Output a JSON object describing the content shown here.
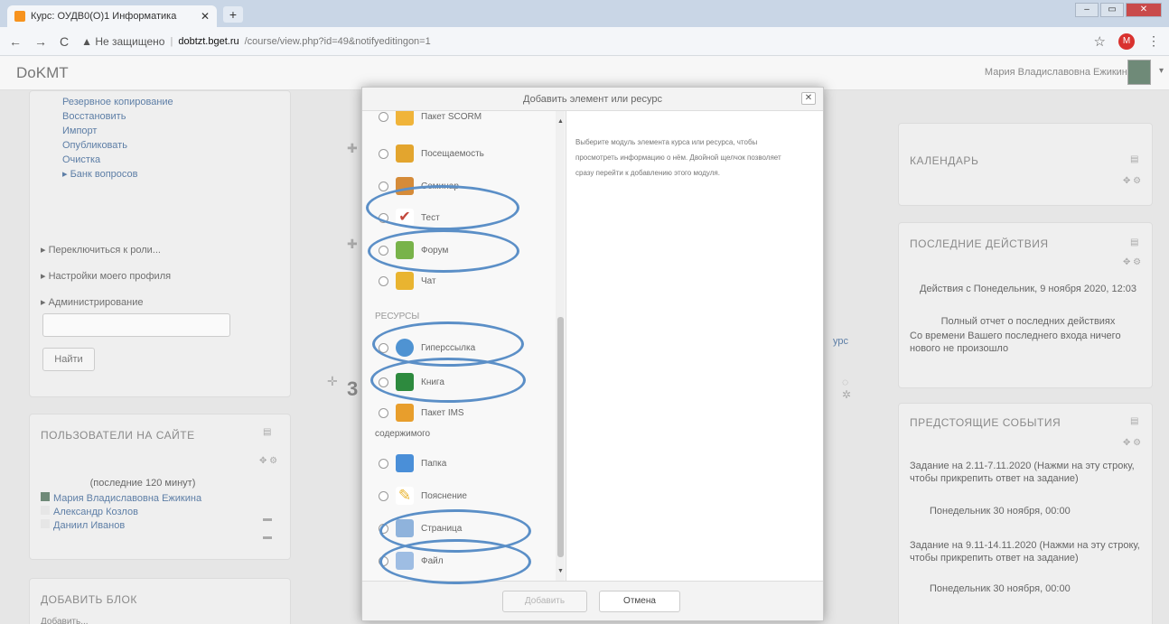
{
  "browser": {
    "tab_title": "Курс: ОУДВ0(О)1 Информатика",
    "tab_close": "✕",
    "new_tab": "+",
    "nav_back": "←",
    "nav_forward": "→",
    "reload": "C",
    "security_warning": "▲ Не защищено",
    "url_host": "dobtzt.bget.ru",
    "url_path": "/course/view.php?id=49&notifyeditingon=1",
    "profile_initial": "M"
  },
  "navbar": {
    "brand": "DoKMT",
    "user_name": "Мария Владиславовна Ежикина"
  },
  "left": {
    "admin_items": [
      "Резервное копирование",
      "Восстановить",
      "Импорт",
      "Опубликовать",
      "Очистка",
      "▸ Банк вопросов"
    ],
    "menu_items": [
      "▸ Переключиться к роли...",
      "▸ Настройки моего профиля",
      "▸ Администрирование"
    ],
    "search_button": "Найти",
    "online_title": "ПОЛЬЗОВАТЕЛИ НА САЙТЕ",
    "online_period": "(последние 120 минут)",
    "online_users": [
      "Мария Владиславовна Ежикина",
      "Александр Козлов",
      "Даниил Иванов"
    ],
    "add_block_title": "ДОБАВИТЬ БЛОК",
    "add_block_select": "Добавить..."
  },
  "center": {
    "section_number": "3",
    "resource_link_fragment": "урс"
  },
  "right": {
    "calendar_title": "КАЛЕНДАРЬ",
    "recent_title": "ПОСЛЕДНИЕ ДЕЙСТВИЯ",
    "recent_since": "Действия с Понедельник, 9 ноября 2020, 12:03",
    "recent_full_report": "Полный отчет о последних действиях",
    "recent_nothing": "Со времени Вашего последнего входа ничего нового не произошло",
    "upcoming_title": "ПРЕДСТОЯЩИЕ СОБЫТИЯ",
    "event1": "Задание на 2.11-7.11.2020 (Нажми на эту строку, чтобы прикрепить ответ на задание)",
    "event1_date": "Понедельник 30 ноября, 00:00",
    "event2": "Задание на 9.11-14.11.2020 (Нажми на эту строку, чтобы прикрепить ответ на задание)",
    "event2_date": "Понедельник 30 ноября, 00:00"
  },
  "modal": {
    "title": "Добавить элемент или ресурс",
    "close": "✕",
    "options": [
      {
        "label": "Пакет SCORM",
        "color": "#f0b43a"
      },
      {
        "label": "Посещаемость",
        "color": "#e3a52e"
      },
      {
        "label": "Семинар",
        "color": "#d58b39"
      },
      {
        "label": "Тест",
        "color": "#c2473c"
      },
      {
        "label": "Форум",
        "color": "#78b34a"
      },
      {
        "label": "Чат",
        "color": "#e9b430"
      }
    ],
    "resources_label": "РЕСУРСЫ",
    "resources": [
      {
        "label": "Гиперссылка",
        "color": "#4f93d2"
      },
      {
        "label": "Книга",
        "color": "#2d8a3e"
      },
      {
        "label": "Пакет IMS",
        "label2": "содержимого",
        "color": "#e89e2c"
      },
      {
        "label": "Папка",
        "color": "#4a8fd8"
      },
      {
        "label": "Пояснение",
        "color": "#e9b430"
      },
      {
        "label": "Страница",
        "color": "#8fb3dc"
      },
      {
        "label": "Файл",
        "color": "#9ebde3"
      }
    ],
    "help": "Выберите модуль элемента курса или ресурса, чтобы просмотреть информацию о нём. Двойной щелчок позволяет сразу перейти к добавлению этого модуля.",
    "add_button": "Добавить",
    "cancel_button": "Отмена"
  },
  "annotation_color": "#5b8fc7"
}
